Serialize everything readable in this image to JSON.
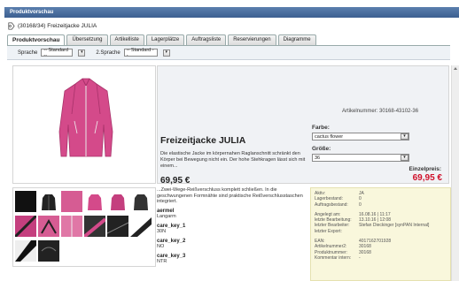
{
  "window": {
    "title": "Produktvorschau"
  },
  "breadcrumb": {
    "text": "(30168/34) Freizeitjacke JULIA"
  },
  "tabs": [
    {
      "label": "Produktvorschau",
      "active": true
    },
    {
      "label": "Übersetzung"
    },
    {
      "label": "Artikelliste"
    },
    {
      "label": "Lagerplätze"
    },
    {
      "label": "Auftragsliste"
    },
    {
      "label": "Reservierungen"
    },
    {
      "label": "Diagramme"
    }
  ],
  "language": {
    "label1": "Sprache",
    "value1": "-- Standard --",
    "label2": "2.Sprache",
    "value2": "-- Standard --"
  },
  "product": {
    "article_number": "Artikelnummer: 30168-43102-36",
    "name": "Freizeitjacke JULIA",
    "description": "Die elastische Jacke im körpernahen Raglanschnitt schränkt den Körper bei Bewegung nicht ein. Der hohe Stehkragen lässt sich mit einem...",
    "price": "69,95 €",
    "color_label": "Farbe:",
    "color_value": "cactus flower",
    "size_label": "Größe:",
    "size_value": "36",
    "single_price_label": "Einzelpreis:",
    "single_price_value": "69,95 €"
  },
  "details": {
    "intro": "...Zwei-Wege-Reißverschluss komplett schließen. In die geschwungenen Formnähte sind praktische Reißverschlusstaschen integriert.",
    "fields": [
      {
        "title": "aermel",
        "value": "Langarm"
      },
      {
        "title": "care_key_1",
        "value": "30N"
      },
      {
        "title": "care_key_2",
        "value": "NO"
      },
      {
        "title": "care_key_3",
        "value": "NTR"
      }
    ]
  },
  "info": {
    "group1": [
      {
        "k": "Aktiv:",
        "v": "JA"
      },
      {
        "k": "Lagerbestand:",
        "v": "0"
      },
      {
        "k": "Auftragsbestand:",
        "v": "0"
      }
    ],
    "group2": [
      {
        "k": "Angelegt am:",
        "v": "16.08.16 | 11:17"
      },
      {
        "k": "letzte Bearbeitung:",
        "v": "13.10.16 | 12:08"
      },
      {
        "k": "letzter Bearbeiter:",
        "v": "Stefan Dieckinger [synPAN Internal]"
      },
      {
        "k": "letzter Export:",
        "v": ""
      }
    ],
    "group3": [
      {
        "k": "EAN:",
        "v": "4017162701928"
      },
      {
        "k": "Artikelnummer2:",
        "v": "30168"
      },
      {
        "k": "Produktnummer:",
        "v": "30168"
      },
      {
        "k": "Kommentar intern:",
        "v": "-"
      }
    ]
  },
  "colors": {
    "header": "#3c5f90",
    "price_red": "#d0102a",
    "jacket_pink": "#d44a8a"
  }
}
